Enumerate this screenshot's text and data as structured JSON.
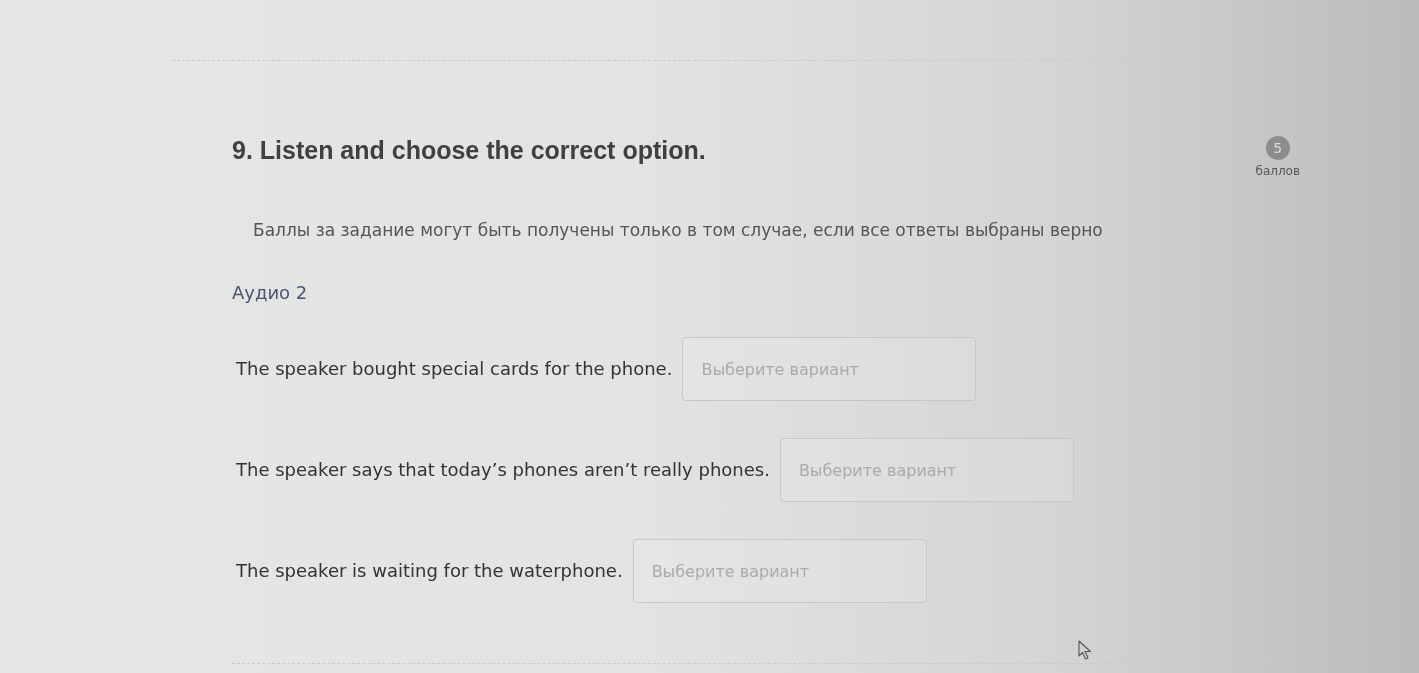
{
  "question": {
    "title": "9. Listen and choose the correct option.",
    "points": {
      "value": "5",
      "label": "баллов"
    }
  },
  "note": "Баллы за задание могут быть получены только в том случае, если все ответы выбраны верно",
  "audio_label": "Аудио 2",
  "items": [
    {
      "statement": "The speaker bought special cards for the phone.",
      "answer": {
        "placeholder": "Выберите вариант"
      }
    },
    {
      "statement": "The speaker says that today’s phones aren’t really phones.",
      "answer": {
        "placeholder": "Выберите вариант"
      }
    },
    {
      "statement": "The speaker is waiting for the waterphone.",
      "answer": {
        "placeholder": "Выберите вариант"
      }
    }
  ]
}
